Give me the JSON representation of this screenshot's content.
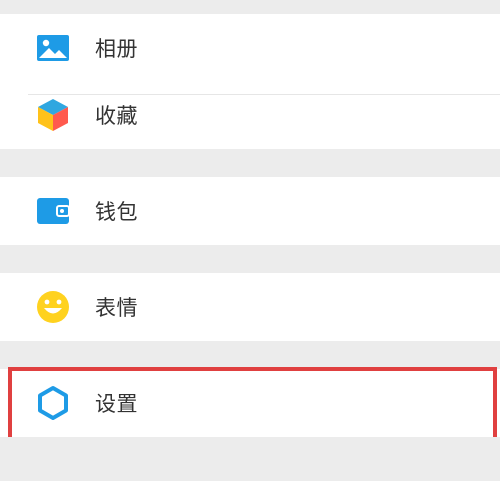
{
  "menu": {
    "items": [
      {
        "label": "相册",
        "icon": "album-icon"
      },
      {
        "label": "收藏",
        "icon": "favorites-icon"
      },
      {
        "label": "钱包",
        "icon": "wallet-icon"
      },
      {
        "label": "表情",
        "icon": "emoji-icon"
      },
      {
        "label": "设置",
        "icon": "settings-icon"
      }
    ]
  },
  "colors": {
    "background": "#ececec",
    "card": "#ffffff",
    "primary_blue": "#1e9be6",
    "highlight_red": "#e04040",
    "emoji_yellow": "#ffd21f"
  }
}
